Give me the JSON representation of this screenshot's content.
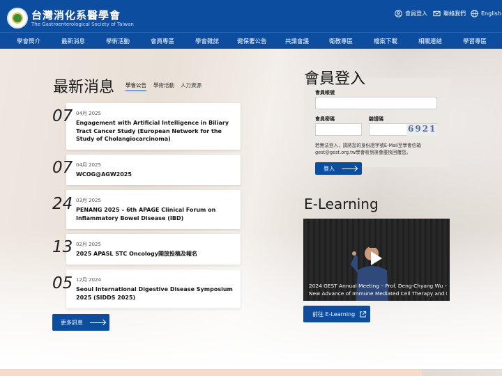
{
  "header": {
    "title": "台灣消化系醫學會",
    "subtitle": "The Gastroenterological Society of Taiwan",
    "util": [
      {
        "label": "會員登入",
        "icon": "user-icon"
      },
      {
        "label": "聯絡我們",
        "icon": "mail-icon"
      },
      {
        "label": "English",
        "icon": "globe-icon"
      }
    ]
  },
  "nav": [
    "學會簡介",
    "最新消息",
    "學術活動",
    "會員專區",
    "學會雜誌",
    "健保署公告",
    "共識會議",
    "衛教專區",
    "檔案下載",
    "相關連結",
    "學習專區"
  ],
  "news": {
    "title": "最新消息",
    "tabs": [
      "學會公告",
      "學術活動",
      "人力資源"
    ],
    "items": [
      {
        "day": "07",
        "date": "04月 2025",
        "headline": "Engagement with Artificial Intelligence in Biliary Tract Cancer Study (European Network for the Study of Cholangiocarcinoma)"
      },
      {
        "day": "07",
        "date": "04月 2025",
        "headline": "WCOG@AGW2025"
      },
      {
        "day": "24",
        "date": "03月 2025",
        "headline": "PENANG 2025 – 6th APAGE Clinical Forum on Inflammatory Bowel Disease (IBD)"
      },
      {
        "day": "13",
        "date": "02月 2025",
        "headline": "2025 APASL STC Oncology開放投稿及報名"
      },
      {
        "day": "05",
        "date": "12月 2024",
        "headline": "Seoul International Digestive Disease Symposium 2025 (SIDDS 2025)"
      }
    ],
    "more_label": "更多訊息"
  },
  "login": {
    "title": "會員登入",
    "account_label": "會員帳號",
    "password_label": "會員密碼",
    "captcha_label": "驗證碼",
    "captcha_text": "6921",
    "note": "若無法登入，請將您的身份證字號E-Mail至學會信箱gest@gest.org.tw學會收到後會盡快回覆您。",
    "submit_label": "登入"
  },
  "elearning": {
    "title": "E-Learning",
    "video_caption_1": "2024 GEST Annual Meeting – Prof. Deng-Chyang Wu –",
    "video_caption_2": "New Advance of Immune Mediated Cell Therapy and Mi",
    "button_label": "前往 E-Learning"
  },
  "colors": {
    "primary": "#0c4da0",
    "band": "#f6dcc6"
  }
}
